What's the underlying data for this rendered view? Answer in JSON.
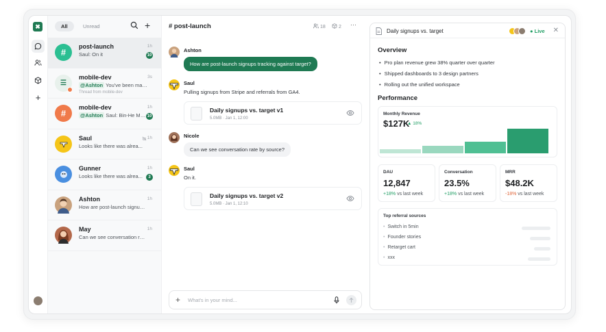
{
  "list": {
    "tabs": [
      {
        "label": "All"
      },
      {
        "label": "Unread"
      }
    ],
    "conversations": [
      {
        "name": "post-launch",
        "preview": "Saul: On it",
        "time": "1h",
        "badge": "10",
        "avatar_color": "#2bbf92"
      },
      {
        "name": "mobile-dev",
        "mention": "@Ashton",
        "preview": "You've been mar...",
        "thread": "Thread from mobile-dev",
        "time": "3s",
        "avatar_color": "#e8f1ec"
      },
      {
        "name": "mobile-dev",
        "mention": "@Ashton",
        "preview": "Saul: Bin-He Mo...",
        "time": "1h",
        "badge": "10",
        "avatar_color": "#f07a4a"
      },
      {
        "name": "Saul",
        "preview": "Looks like there was alrea...",
        "time": "1h"
      },
      {
        "name": "Gunner",
        "preview": "Looks like there was alrea...",
        "time": "1h",
        "badge": "3"
      },
      {
        "name": "Ashton",
        "preview": "How are post-launch signups...",
        "time": "1h"
      },
      {
        "name": "May",
        "preview": "Can we see conversation rate...",
        "time": "1h"
      }
    ]
  },
  "chat": {
    "channel": "# post-launch",
    "members": "18",
    "files": "2",
    "messages": [
      {
        "author": "Ashton",
        "text": "How are post-launch signups tracking against target?"
      },
      {
        "author": "Saul",
        "text": "Pulling signups from Stripe and referrals from GA4.",
        "file_title": "Daily signups vs. target v1",
        "file_meta": "5.0MB · Jan 1, 12:00"
      },
      {
        "author": "Nicole",
        "text": "Can we see conversation rate by source?"
      },
      {
        "author": "Saul",
        "text": "On it.",
        "file_title": "Daily signups vs. target v2",
        "file_meta": "5.0MB · Jan 1, 12:10"
      }
    ],
    "composer_placeholder": "What's in your mind..."
  },
  "panel": {
    "title": "Daily signups vs. target",
    "live": "Live",
    "overview_heading": "Overview",
    "bullets": [
      "Pro plan revenue grew 38% quarter over quarter",
      "Shipped dashboards to 3 design partners",
      "Rolling out the unified workspace"
    ],
    "performance_heading": "Performance",
    "monthly_revenue": {
      "label": "Monthly Revenue",
      "value": "$127K",
      "delta": "▲ 18%",
      "bars": [
        8,
        14,
        22,
        48
      ]
    },
    "stats": [
      {
        "label": "DAU",
        "value": "12,847",
        "delta": "+18%",
        "suffix": "vs last week",
        "trend": "up"
      },
      {
        "label": "Conversation",
        "value": "23.5%",
        "delta": "+18%",
        "suffix": "vs last week",
        "trend": "up"
      },
      {
        "label": "MRR",
        "value": "$48.2K",
        "delta": "-18%",
        "suffix": "vs last week",
        "trend": "down"
      }
    ],
    "sources_heading": "Top referral sources",
    "sources": [
      {
        "label": "Switch in 5min",
        "share": 0.7
      },
      {
        "label": "Founder stories",
        "share": 0.5
      },
      {
        "label": "Retarget cart",
        "share": 0.4
      },
      {
        "label": "xxx",
        "share": 0.55
      }
    ]
  },
  "colors": {
    "accent": "#1f7a53",
    "positive": "#1f9d63",
    "negative": "#e0663a"
  }
}
